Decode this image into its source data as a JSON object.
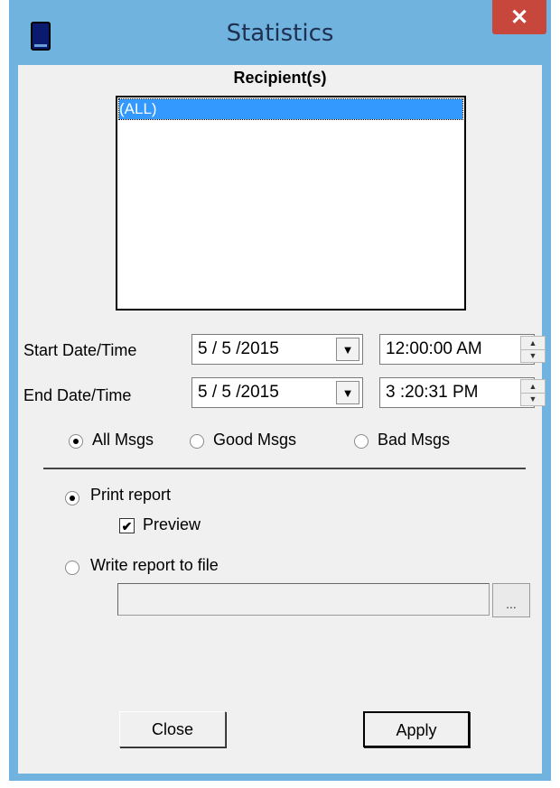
{
  "window": {
    "title": "Statistics",
    "close_glyph": "✕"
  },
  "recipients": {
    "heading": "Recipient(s)",
    "items": [
      "(ALL)"
    ]
  },
  "start": {
    "label": "Start Date/Time",
    "date": "5 / 5 /2015",
    "time": "12:00:00 AM"
  },
  "end": {
    "label": "End Date/Time",
    "date": "5 / 5 /2015",
    "time": "3 :20:31 PM"
  },
  "msg_filter": {
    "options": [
      "All Msgs",
      "Good Msgs",
      "Bad Msgs"
    ],
    "selected": "All Msgs"
  },
  "output": {
    "print_label": "Print report",
    "preview_label": "Preview",
    "preview_checked": true,
    "write_label": "Write report to file",
    "file_path": "",
    "browse_label": "...",
    "selected": "Print report"
  },
  "buttons": {
    "close": "Close",
    "apply": "Apply"
  },
  "icons": {
    "app": "app-icon",
    "combo": "dropdown-arrow-icon",
    "spin": "spinner-icon"
  }
}
